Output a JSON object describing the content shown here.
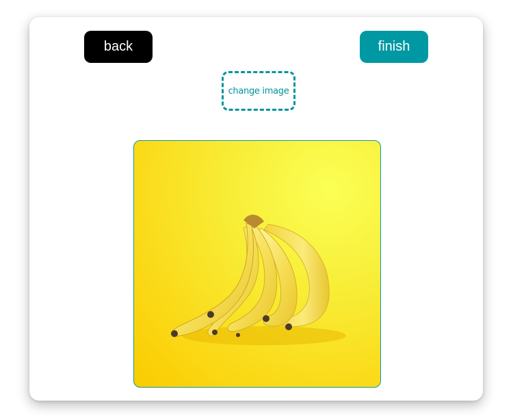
{
  "buttons": {
    "back_label": "back",
    "finish_label": "finish",
    "change_image_label": "change image"
  },
  "image": {
    "subject": "bunch of bananas",
    "background_color": "#fbd511"
  },
  "colors": {
    "accent": "#0099a3",
    "back_button": "#000000",
    "image_border": "#0b9aa5"
  }
}
